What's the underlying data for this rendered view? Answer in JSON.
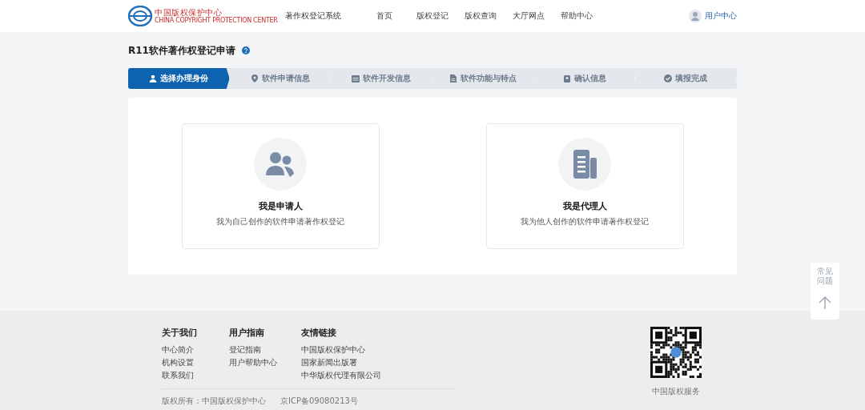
{
  "header": {
    "logo_cn": "中国版权保护中心",
    "logo_en": "CHINA COPYRIGHT PROTECTION CENTER",
    "system_name": "著作权登记系统",
    "nav": [
      {
        "label": "首页"
      },
      {
        "label": "版权登记"
      },
      {
        "label": "版权查询"
      },
      {
        "label": "大厅网点"
      },
      {
        "label": "帮助中心"
      }
    ],
    "user_center": "用户中心"
  },
  "page_title": "R11软件著作权登记申请",
  "steps": [
    {
      "label": "选择办理身份",
      "kind": "person",
      "selected": true
    },
    {
      "label": "软件申请信息",
      "kind": "pin",
      "selected": false
    },
    {
      "label": "软件开发信息",
      "kind": "calendar",
      "selected": false
    },
    {
      "label": "软件功能与特点",
      "kind": "document",
      "selected": false
    },
    {
      "label": "确认信息",
      "kind": "badge",
      "selected": false
    },
    {
      "label": "填报完成",
      "kind": "check",
      "selected": false
    }
  ],
  "identity_cards": [
    {
      "kind": "applicant",
      "title": "我是申请人",
      "description": "我为自己创作的软件申请著作权登记"
    },
    {
      "kind": "agent",
      "title": "我是代理人",
      "description": "我为他人创作的软件申请著作权登记"
    }
  ],
  "side_widget": {
    "faq": "常见问题"
  },
  "footer": {
    "columns": [
      {
        "heading": "关于我们",
        "links": [
          "中心简介",
          "机构设置",
          "联系我们"
        ]
      },
      {
        "heading": "用户指南",
        "links": [
          "登记指南",
          "用户帮助中心"
        ]
      },
      {
        "heading": "友情链接",
        "links": [
          "中国版权保护中心",
          "国家新闻出版署",
          "中华版权代理有限公司"
        ]
      }
    ],
    "qr_caption": "中国版权服务",
    "copyright": "版权所有：中国版权保护中心",
    "icp": "京ICP备09080213号"
  }
}
